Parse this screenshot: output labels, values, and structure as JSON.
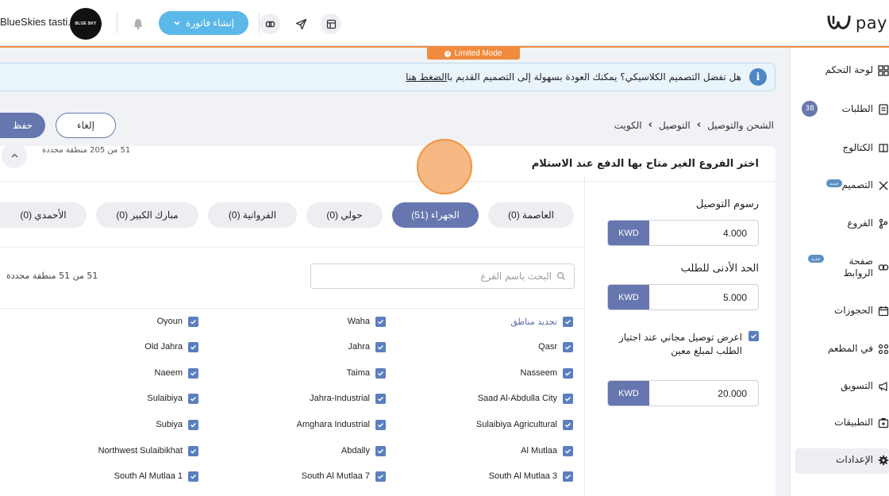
{
  "header": {
    "logo_text": "pay",
    "store_name": "BlueSkies tasti...",
    "store_avatar_text": "BLUE SKY",
    "invoice_button": "إنشاء فاتورة",
    "limited_mode": "Limited Mode"
  },
  "sidebar": {
    "items": [
      {
        "label": "لوحة التحكم",
        "icon": "dashboard-icon"
      },
      {
        "label": "الطلبات",
        "icon": "orders-icon",
        "badge": "38"
      },
      {
        "label": "الكتالوج",
        "icon": "catalog-icon"
      },
      {
        "label": "التصميم",
        "icon": "design-icon",
        "badge_new": "جديد"
      },
      {
        "label": "الفروع",
        "icon": "branches-icon"
      },
      {
        "label": "صفحة الروابط",
        "icon": "links-icon",
        "badge_new": "جديد"
      },
      {
        "label": "الحجوزات",
        "icon": "calendar-icon"
      },
      {
        "label": "في المطعم",
        "icon": "restaurant-icon"
      },
      {
        "label": "التسويق",
        "icon": "megaphone-icon"
      },
      {
        "label": "التطبيقات",
        "icon": "apps-icon"
      },
      {
        "label": "الإعدادات",
        "icon": "gear-icon",
        "active": true
      }
    ]
  },
  "notice": {
    "text": "هل تفضل التصميم الكلاسيكي؟ يمكنك العودة بسهولة إلى التصميم القديم با",
    "link": "الضغط هنا"
  },
  "breadcrumb": {
    "items": [
      "الشحن والتوصيل",
      "التوصيل",
      "الكويت"
    ]
  },
  "actions": {
    "cancel": "إلغاء",
    "save": "حفظ"
  },
  "card": {
    "title": "اختر الفروع الغير متاح بها الدفع عند الاستلام",
    "count_top": "51 من 205 منطقة محددة",
    "delivery_fee_label": "رسوم التوصيل",
    "delivery_fee_value": "4.000",
    "min_order_label": "الحد الأدنى للطلب",
    "min_order_value": "5.000",
    "free_delivery_label": "اعرض توصيل مجاني عند اجتياز الطلب لمبلغ معين",
    "free_delivery_value": "20.000",
    "currency": "KWD",
    "tabs": [
      {
        "label": "العاصمة (0)"
      },
      {
        "label": "الجهراء (51)",
        "active": true
      },
      {
        "label": "حولي (0)"
      },
      {
        "label": "الفروانية (0)"
      },
      {
        "label": "مبارك الكبير (0)"
      },
      {
        "label": "الأحمدي (0)"
      }
    ],
    "search_placeholder": "البحث باسم الفرع",
    "count_mid": "51 من 51 منطقة محددة",
    "areas": {
      "col1": [
        "تحديد مناطق",
        "Qasr",
        "Nasseem",
        "Saad Al-Abdulla City",
        "Sulaibiya Agricultural",
        "Al Mutlaa",
        "South Al Mutlaa 3"
      ],
      "col2": [
        "Waha",
        "Jahra",
        "Taima",
        "Jahra-Industrial",
        "Amghara Industrial",
        "Abdally",
        "South Al Mutlaa 7"
      ],
      "col3": [
        "Oyoun",
        "Old Jahra",
        "Naeem",
        "Sulaibiya",
        "Subiya",
        "Northwest Sulaibikhat",
        "South Al Mutlaa 1"
      ]
    }
  }
}
